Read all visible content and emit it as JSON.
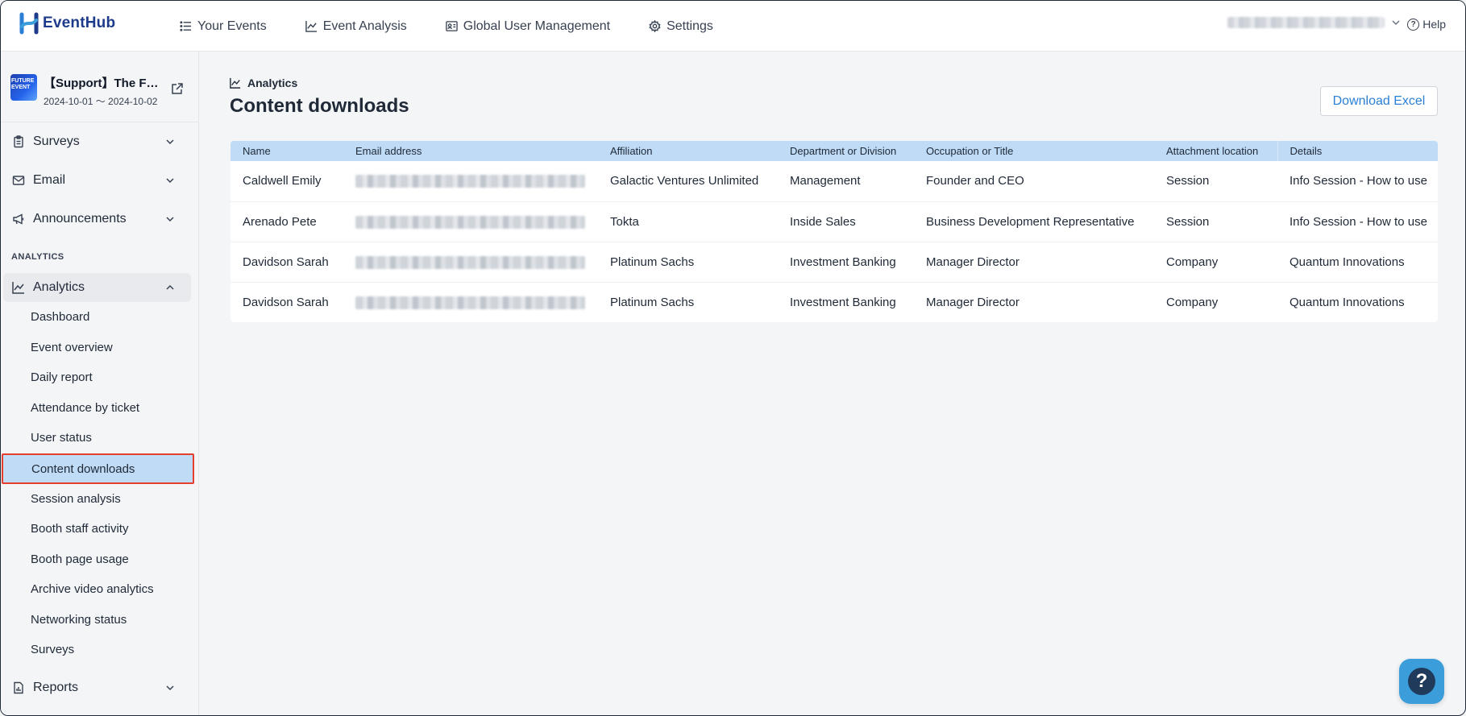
{
  "app": {
    "brand": "EventHub",
    "colors": {
      "brand": "#1e3a8a",
      "accent": "#2b7fd4",
      "selected_bg": "#bfdbf5",
      "highlight": "#e53e2f"
    }
  },
  "topnav": {
    "items": [
      {
        "label": "Your Events",
        "icon": "list-icon"
      },
      {
        "label": "Event Analysis",
        "icon": "chart-line-icon"
      },
      {
        "label": "Global User Management",
        "icon": "id-card-icon"
      },
      {
        "label": "Settings",
        "icon": "gear-icon"
      }
    ],
    "help_label": "Help"
  },
  "sidebar": {
    "event": {
      "title": "【Support】The F…",
      "dates": "2024-10-01 ～ 2024-10-02",
      "thumb_text": "FUTURE EVENT"
    },
    "groups": {
      "surveys": "Surveys",
      "email": "Email",
      "announcements": "Announcements",
      "analytics": "Analytics",
      "reports": "Reports"
    },
    "section_label": "ANALYTICS",
    "analytics_items": [
      "Dashboard",
      "Event overview",
      "Daily report",
      "Attendance by ticket",
      "User status",
      "Content downloads",
      "Session analysis",
      "Booth staff activity",
      "Booth page usage",
      "Archive video analytics",
      "Networking status",
      "Surveys"
    ]
  },
  "main": {
    "breadcrumb": "Analytics",
    "title": "Content downloads",
    "download_button": "Download Excel",
    "table": {
      "headers": [
        "Name",
        "Email address",
        "Affiliation",
        "Department or Division",
        "Occupation or Title",
        "Attachment location",
        "Details"
      ],
      "rows": [
        [
          "Caldwell Emily",
          "",
          "Galactic Ventures Unlimited",
          "Management",
          "Founder and CEO",
          "Session",
          "Info Session - How to use"
        ],
        [
          "Arenado Pete",
          "",
          "Tokta",
          "Inside Sales",
          "Business Development Representative",
          "Session",
          "Info Session - How to use"
        ],
        [
          "Davidson Sarah",
          "",
          "Platinum Sachs",
          "Investment Banking",
          "Manager Director",
          "Company",
          "Quantum Innovations"
        ],
        [
          "Davidson Sarah",
          "",
          "Platinum Sachs",
          "Investment Banking",
          "Manager Director",
          "Company",
          "Quantum Innovations"
        ]
      ]
    }
  },
  "fab": {
    "icon": "question-icon"
  }
}
